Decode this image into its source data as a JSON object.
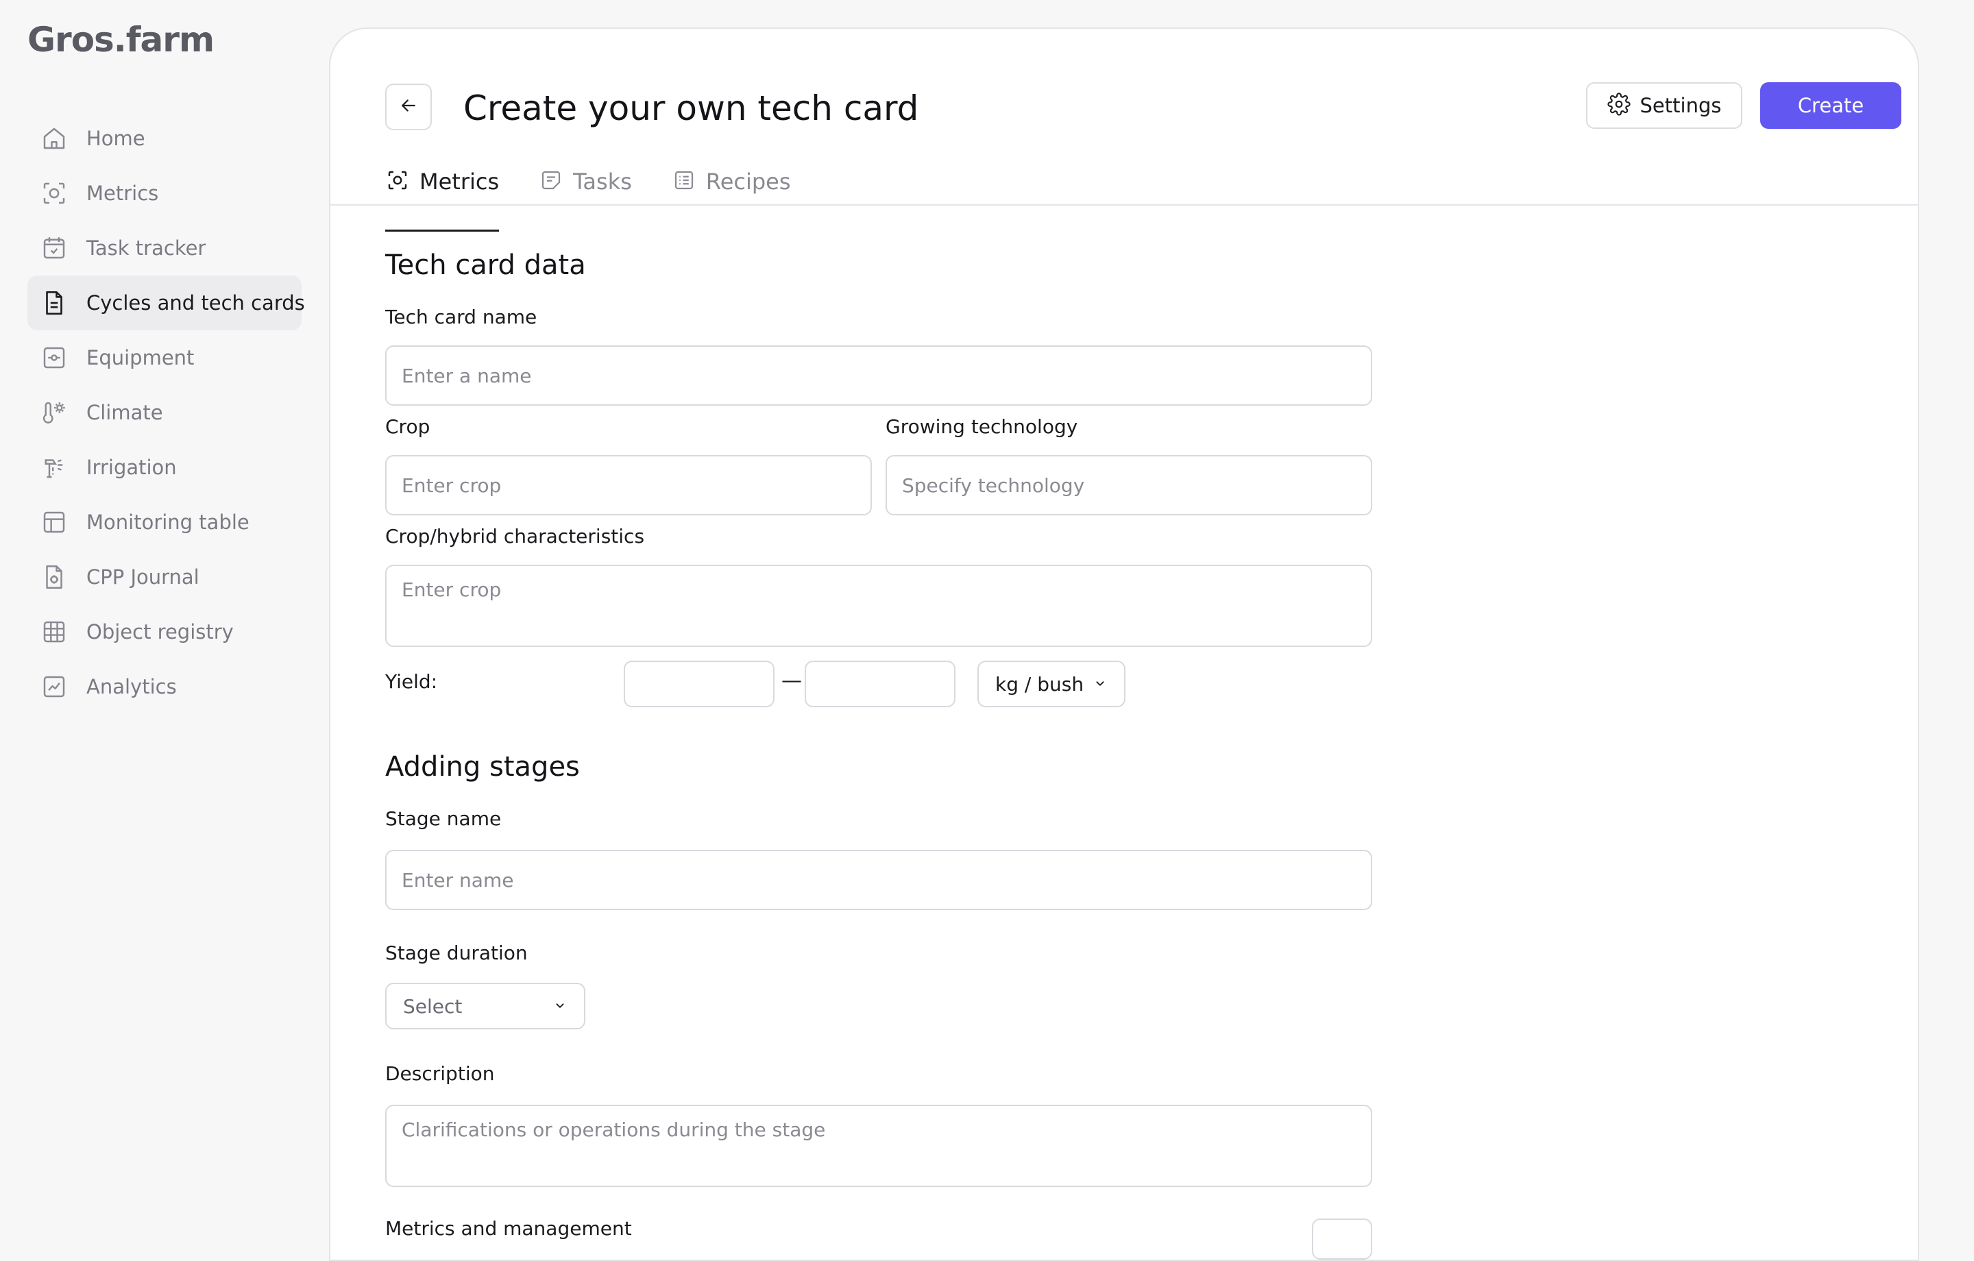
{
  "app": {
    "logo": "Gros.farm"
  },
  "sidebar": {
    "items": [
      {
        "label": "Home",
        "icon": "home-icon"
      },
      {
        "label": "Metrics",
        "icon": "metrics-icon"
      },
      {
        "label": "Task tracker",
        "icon": "calendar-check-icon"
      },
      {
        "label": "Cycles and tech cards",
        "icon": "document-icon",
        "active": true
      },
      {
        "label": "Equipment",
        "icon": "equipment-icon"
      },
      {
        "label": "Climate",
        "icon": "thermometer-sun-icon"
      },
      {
        "label": "Irrigation",
        "icon": "irrigation-icon"
      },
      {
        "label": "Monitoring table",
        "icon": "table-icon"
      },
      {
        "label": "CPP Journal",
        "icon": "journal-icon"
      },
      {
        "label": "Object registry",
        "icon": "grid-icon"
      },
      {
        "label": "Analytics",
        "icon": "analytics-icon"
      }
    ]
  },
  "header": {
    "title": "Create your own tech card",
    "settings_label": "Settings",
    "create_label": "Create"
  },
  "tabs": [
    {
      "label": "Metrics",
      "active": true
    },
    {
      "label": "Tasks"
    },
    {
      "label": "Recipes"
    }
  ],
  "tech_card": {
    "section_title": "Tech card data",
    "name_label": "Tech card name",
    "name_placeholder": "Enter a name",
    "crop_label": "Crop",
    "crop_placeholder": "Enter crop",
    "technology_label": "Growing technology",
    "technology_placeholder": "Specify technology",
    "characteristics_label": "Crop/hybrid characteristics",
    "characteristics_placeholder": "Enter crop",
    "yield_label": "Yield:",
    "yield_separator": "—",
    "yield_unit": "kg / bush"
  },
  "stages": {
    "section_title": "Adding stages",
    "stage_name_label": "Stage name",
    "stage_name_placeholder": "Enter name",
    "duration_label": "Stage duration",
    "duration_value": "Select",
    "description_label": "Description",
    "description_placeholder": "Clarifications or operations during the stage",
    "metrics_label": "Metrics and management"
  },
  "colors": {
    "accent": "#6257f0",
    "background": "#f7f7f8",
    "card": "#ffffff",
    "border": "#d9d9de"
  }
}
